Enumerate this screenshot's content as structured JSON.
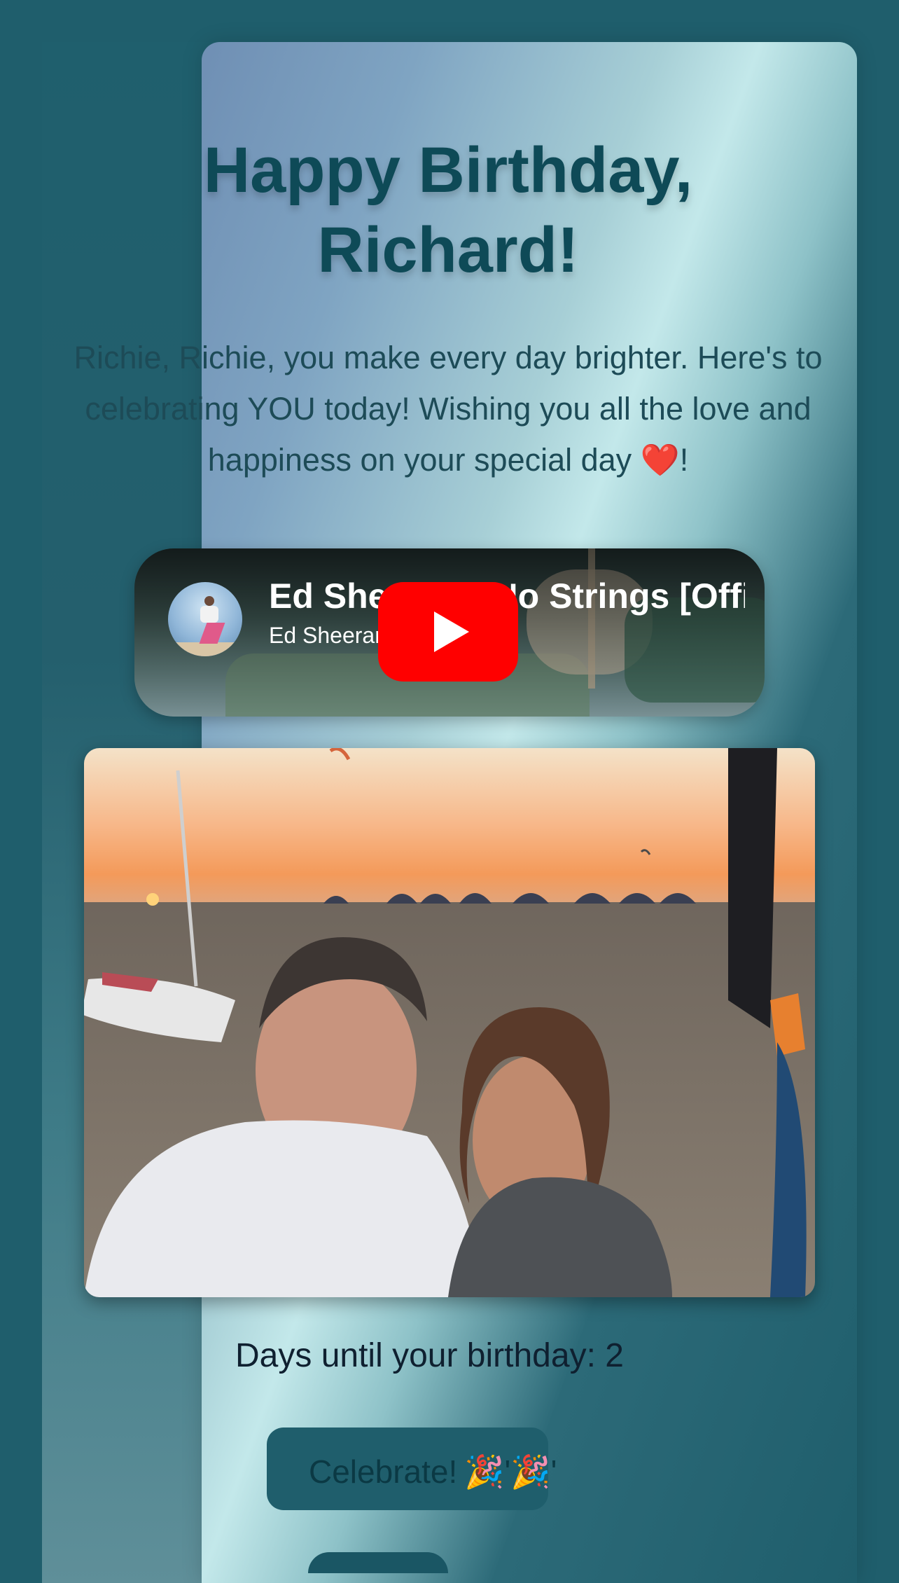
{
  "greeting": {
    "title": "Happy Birthday, Richard!",
    "message": "Richie, Richie, you make every day brighter. Here's to celebrating YOU today! Wishing you all the love and happiness on your special day ❤️!"
  },
  "video": {
    "title": "Ed Sheeran - No Strings [Official Video]",
    "channel": "Ed Sheeran",
    "play_icon": "youtube-play-icon"
  },
  "photo": {
    "description_icon": "beach-selfie-photo"
  },
  "countdown": {
    "text": "Days until your birthday: 2"
  },
  "celebrate_button": {
    "label": "Celebrate!",
    "emoji": "🎉'🎉'"
  },
  "colors": {
    "background": "#1f5e6c",
    "title": "#0e4a57",
    "play_button": "#ff0000"
  }
}
